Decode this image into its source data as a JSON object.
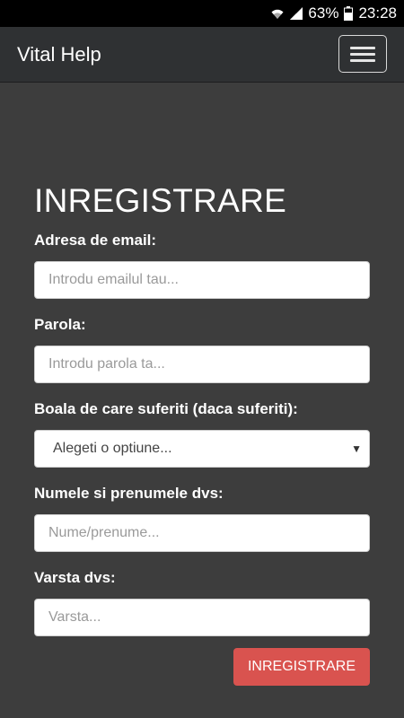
{
  "status_bar": {
    "battery": "63%",
    "time": "23:28",
    "icons": [
      "wifi-icon",
      "signal-icon",
      "battery-icon"
    ]
  },
  "navbar": {
    "brand": "Vital Help",
    "toggle_icon": "hamburger-menu-icon"
  },
  "form": {
    "title": "INREGISTRARE",
    "email": {
      "label": "Adresa de email:",
      "placeholder": "Introdu emailul tau..."
    },
    "password": {
      "label": "Parola:",
      "placeholder": "Introdu parola ta..."
    },
    "disease": {
      "label": "Boala de care suferiti (daca suferiti):",
      "selected": "Alegeti o optiune..."
    },
    "name": {
      "label": "Numele si prenumele dvs:",
      "placeholder": "Nume/prenume..."
    },
    "age": {
      "label": "Varsta dvs:",
      "placeholder": "Varsta..."
    },
    "submit_label": "INREGISTRARE"
  },
  "colors": {
    "background": "#3d3d3d",
    "navbar": "#2f3133",
    "submit_button": "#d9534f"
  }
}
